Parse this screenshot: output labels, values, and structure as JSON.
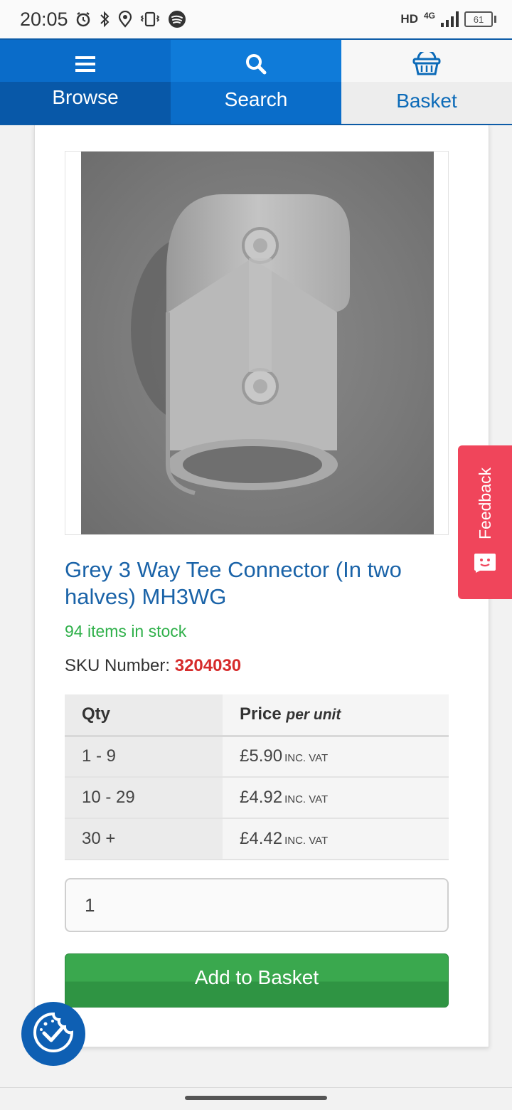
{
  "status_bar": {
    "time": "20:05",
    "network_hd": "HD",
    "network_type": "4G",
    "battery": "61",
    "icons": [
      "alarm-icon",
      "bluetooth-icon",
      "location-icon",
      "vibrate-icon",
      "spotify-icon"
    ]
  },
  "nav": {
    "browse": "Browse",
    "search": "Search",
    "basket": "Basket"
  },
  "product": {
    "title": "Grey 3 Way Tee Connector (In two halves) MH3WG",
    "stock": "94 items in stock",
    "sku_label": "SKU Number:",
    "sku_value": "3204030"
  },
  "price_table": {
    "header_qty": "Qty",
    "header_price": "Price",
    "header_per_unit": "per unit",
    "rows": [
      {
        "qty": "1 - 9",
        "price": "£5.90",
        "vat": "INC. VAT"
      },
      {
        "qty": "10 - 29",
        "price": "£4.92",
        "vat": "INC. VAT"
      },
      {
        "qty": "30 +",
        "price": "£4.42",
        "vat": "INC. VAT"
      }
    ]
  },
  "quantity_input": {
    "value": "1"
  },
  "add_button": "Add to Basket",
  "feedback": "Feedback",
  "colors": {
    "brand_blue": "#0a6cc9",
    "title_blue": "#1a63a8",
    "stock_green": "#2fb04a",
    "sku_red": "#d62b2b",
    "button_green": "#3aa84e",
    "feedback_red": "#f0455b"
  }
}
